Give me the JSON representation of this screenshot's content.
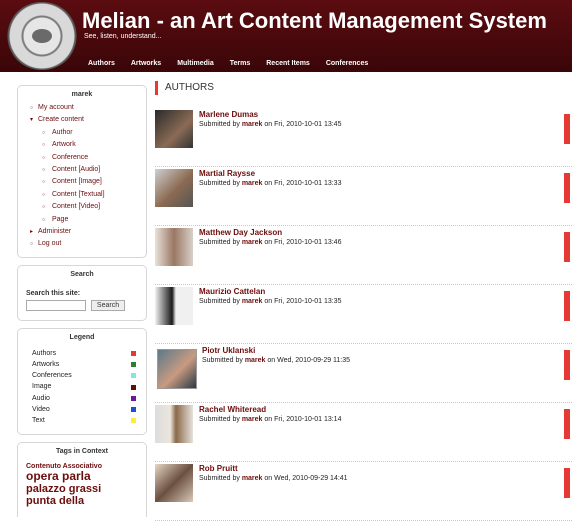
{
  "site": {
    "title": "Melian - an Art Content Management System",
    "slogan": "See, listen, understand..."
  },
  "nav": [
    "Authors",
    "Artworks",
    "Multimedia",
    "Terms",
    "Recent Items",
    "Conferences"
  ],
  "user_block": {
    "title": "marek",
    "items": [
      {
        "label": "My account"
      },
      {
        "label": "Create content"
      },
      {
        "label": "Author"
      },
      {
        "label": "Artwork"
      },
      {
        "label": "Conference"
      },
      {
        "label": "Content [Audio]"
      },
      {
        "label": "Content [Image]"
      },
      {
        "label": "Content [Textual]"
      },
      {
        "label": "Content [Video]"
      },
      {
        "label": "Page"
      },
      {
        "label": "Administer"
      },
      {
        "label": "Log out"
      }
    ]
  },
  "search": {
    "title": "Search",
    "label": "Search this site:",
    "button": "Search"
  },
  "legend": {
    "title": "Legend",
    "items": [
      {
        "label": "Authors",
        "color": "#e53935"
      },
      {
        "label": "Artworks",
        "color": "#2e7d32"
      },
      {
        "label": "Conferences",
        "color": "#80e8e0"
      },
      {
        "label": "Image",
        "color": "#5d0f12"
      },
      {
        "label": "Audio",
        "color": "#6a1b9a"
      },
      {
        "label": "Video",
        "color": "#1e4fd8"
      },
      {
        "label": "Text",
        "color": "#ffee33"
      }
    ]
  },
  "tags": {
    "title": "Tags in Context",
    "items": [
      "Contenuto Associativo",
      "opera parla",
      "palazzo grassi",
      "punta della"
    ]
  },
  "main": {
    "title": "AUTHORS",
    "nodes": [
      {
        "name": "Marlene Dumas",
        "submitted_by": "Submitted by",
        "author": "marek",
        "date": "on Fri, 2010-10-01 13:45"
      },
      {
        "name": "Martial Raysse",
        "submitted_by": "Submitted by",
        "author": "marek",
        "date": "on Fri, 2010-10-01 13:33"
      },
      {
        "name": "Matthew Day Jackson",
        "submitted_by": "Submitted by",
        "author": "marek",
        "date": "on Fri, 2010-10-01 13:46"
      },
      {
        "name": "Maurizio Cattelan",
        "submitted_by": "Submitted by",
        "author": "marek",
        "date": "on Fri, 2010-10-01 13:35"
      },
      {
        "name": "Piotr Uklanski",
        "submitted_by": "Submitted by",
        "author": "marek",
        "date": "on Wed, 2010-09-29 11:35"
      },
      {
        "name": "Rachel Whiteread",
        "submitted_by": "Submitted by",
        "author": "marek",
        "date": "on Fri, 2010-10-01 13:14"
      },
      {
        "name": "Rob Pruitt",
        "submitted_by": "Submitted by",
        "author": "marek",
        "date": "on Wed, 2010-09-29 14:41"
      }
    ]
  }
}
